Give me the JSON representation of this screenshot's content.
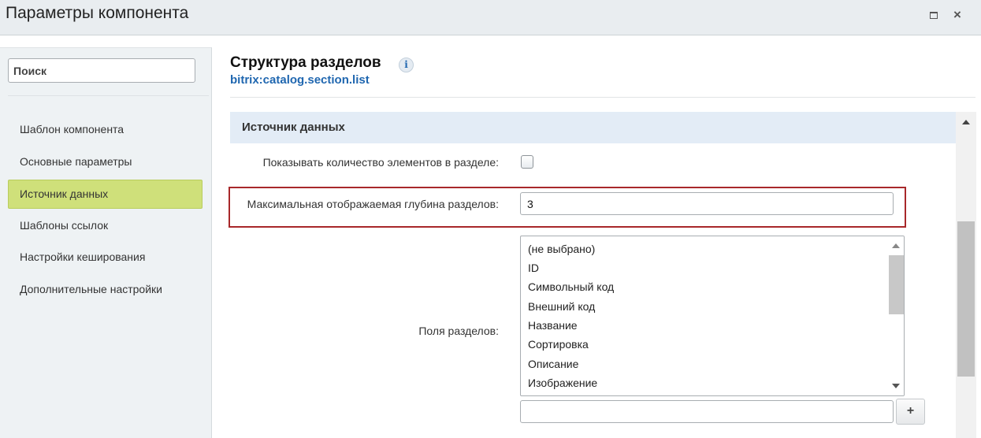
{
  "window": {
    "title": "Параметры компонента",
    "maximize_icon": "maximize-icon",
    "close_icon": "close-icon",
    "close_glyph": "×"
  },
  "sidebar": {
    "search_placeholder": "Поиск",
    "items": [
      {
        "label": "Шаблон компонента",
        "active": false
      },
      {
        "label": "Основные параметры",
        "active": false
      },
      {
        "label": "Источник данных",
        "active": true
      },
      {
        "label": "Шаблоны ссылок",
        "active": false
      },
      {
        "label": "Настройки кеширования",
        "active": false
      },
      {
        "label": "Дополнительные настройки",
        "active": false
      }
    ]
  },
  "header": {
    "title": "Структура разделов",
    "info_icon": "info-icon",
    "info_glyph": "i",
    "component_code": "bitrix:catalog.section.list"
  },
  "section": {
    "title": "Источник данных",
    "fields": {
      "show_count_label": "Показывать количество элементов в разделе:",
      "show_count_checked": false,
      "max_depth_label": "Максимальная отображаемая глубина разделов:",
      "max_depth_value": "3",
      "section_fields_label": "Поля разделов:",
      "section_fields_options": [
        "(не выбрано)",
        "ID",
        "Символьный код",
        "Внешний код",
        "Название",
        "Сортировка",
        "Описание",
        "Изображение"
      ],
      "extra_field_value": "",
      "add_button_label": "+"
    }
  },
  "colors": {
    "active_nav": "#cfe07a",
    "highlight_border": "#a8282a",
    "link_blue": "#2067b0",
    "section_header_bg": "#e3ecf6"
  }
}
